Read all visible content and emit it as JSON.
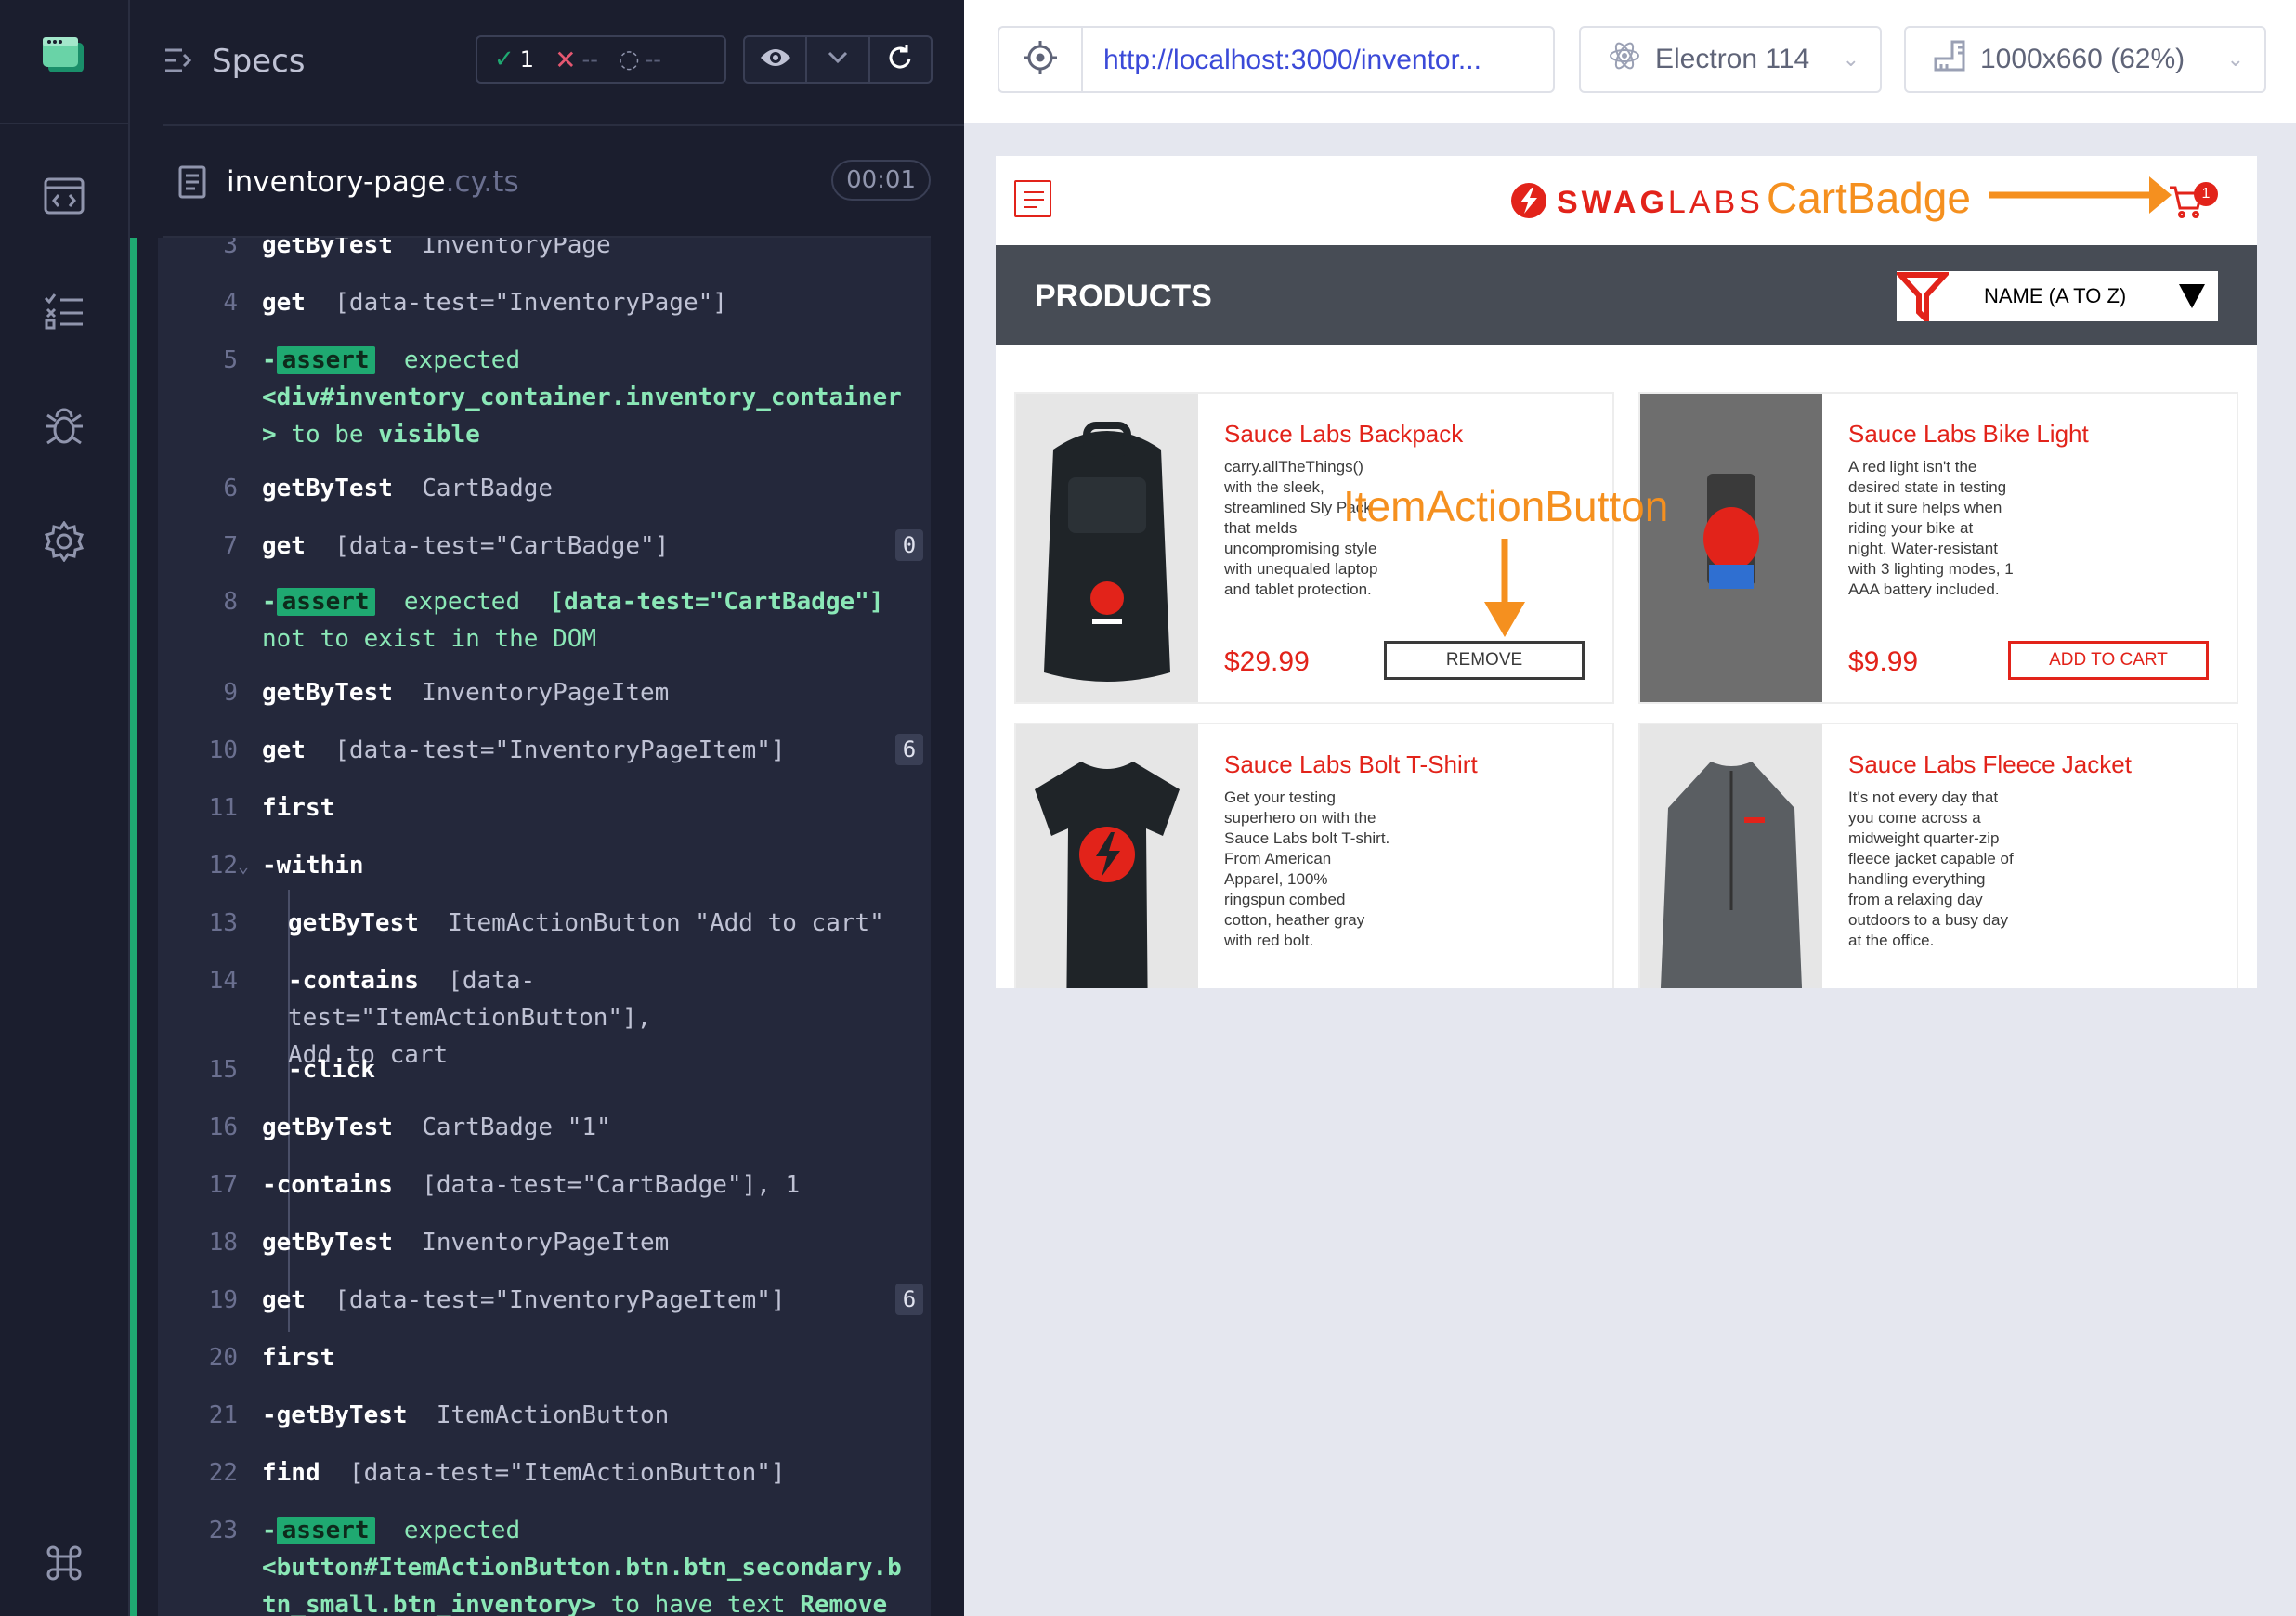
{
  "rail": {
    "icons": [
      "app-logo-icon",
      "specs-nav-icon",
      "runs-nav-icon",
      "debug-nav-icon",
      "settings-nav-icon",
      "keyboard-shortcuts-icon"
    ]
  },
  "reporter": {
    "header": {
      "title": "Specs",
      "passed": "1",
      "failed": "--",
      "pending": "--"
    },
    "spec": {
      "name": "inventory-page",
      "ext": ".cy.ts",
      "duration": "00:01"
    },
    "commands": [
      {
        "num": "3",
        "name": "getByTest",
        "arg": "InventoryPage"
      },
      {
        "num": "4",
        "name": "get",
        "arg": "[data-test=\"InventoryPage\"]"
      },
      {
        "num": "5",
        "name": "-assert",
        "line1": "expected",
        "line2": "<div#inventory_container.inventory_container",
        "line3a": "> ",
        "line3b": "to be",
        "line3c": "visible"
      },
      {
        "num": "6",
        "name": "getByTest",
        "arg": "CartBadge"
      },
      {
        "num": "7",
        "name": "get",
        "arg": "[data-test=\"CartBadge\"]",
        "badge": "0"
      },
      {
        "num": "8",
        "name": "-assert",
        "line1": "expected",
        "line1b": "[data-test=\"CartBadge\"]",
        "line2": "not to exist in the DOM"
      },
      {
        "num": "9",
        "name": "getByTest",
        "arg": "InventoryPageItem"
      },
      {
        "num": "10",
        "name": "get",
        "arg": "[data-test=\"InventoryPageItem\"]",
        "badge": "6"
      },
      {
        "num": "11",
        "name": "first",
        "arg": ""
      },
      {
        "num": "12",
        "name": "-within",
        "arg": ""
      },
      {
        "num": "13",
        "name": "getByTest",
        "arg": "ItemActionButton \"Add to cart\""
      },
      {
        "num": "14",
        "name": "-contains",
        "arg": "[data-test=\"ItemActionButton\"],",
        "arg2": "Add to cart"
      },
      {
        "num": "15",
        "name": "-click",
        "arg": ""
      },
      {
        "num": "16",
        "name": "getByTest",
        "arg": "CartBadge \"1\""
      },
      {
        "num": "17",
        "name": "-contains",
        "arg": "[data-test=\"CartBadge\"], 1"
      },
      {
        "num": "18",
        "name": "getByTest",
        "arg": "InventoryPageItem"
      },
      {
        "num": "19",
        "name": "get",
        "arg": "[data-test=\"InventoryPageItem\"]",
        "badge": "6"
      },
      {
        "num": "20",
        "name": "first",
        "arg": ""
      },
      {
        "num": "21",
        "name": "-getByTest",
        "arg": "ItemActionButton"
      },
      {
        "num": "22",
        "name": "find",
        "arg": "[data-test=\"ItemActionButton\"]"
      },
      {
        "num": "23",
        "name": "-assert",
        "line1": "expected",
        "line2": "<button#ItemActionButton.btn.btn_secondary.b",
        "line3a": "tn_small.btn_inventory>",
        "line3b": "to have text",
        "line3c": "Remove"
      }
    ]
  },
  "preview": {
    "url": "http://localhost:3000/inventor...",
    "browser": "Electron 114",
    "viewport": "1000x660 (62%)"
  },
  "app": {
    "logo_bold": "SWAG",
    "logo_light": "LABS",
    "cart_count": "1",
    "products_title": "PRODUCTS",
    "sort_selected": "NAME (A TO Z)",
    "items": [
      {
        "name": "Sauce Labs Backpack",
        "desc": "carry.allTheThings() with the sleek, streamlined Sly Pack that melds uncompromising style with unequaled laptop and tablet protection.",
        "price": "$29.99",
        "button": "REMOVE"
      },
      {
        "name": "Sauce Labs Bike Light",
        "desc": "A red light isn't the desired state in testing but it sure helps when riding your bike at night. Water-resistant with 3 lighting modes, 1 AAA battery included.",
        "price": "$9.99",
        "button": "ADD TO CART"
      },
      {
        "name": "Sauce Labs Bolt T-Shirt",
        "desc": "Get your testing superhero on with the Sauce Labs bolt T-shirt. From American Apparel, 100% ringspun combed cotton, heather gray with red bolt."
      },
      {
        "name": "Sauce Labs Fleece Jacket",
        "desc": "It's not every day that you come across a midweight quarter-zip fleece jacket capable of handling everything from a relaxing day outdoors to a busy day at the office."
      }
    ]
  },
  "annotations": {
    "cart_badge": "CartBadge",
    "item_action_button": "ItemActionButton"
  },
  "colors": {
    "accent_green": "#1fa971",
    "brand_red": "#e2231a",
    "annotation_orange": "#f5901f"
  }
}
